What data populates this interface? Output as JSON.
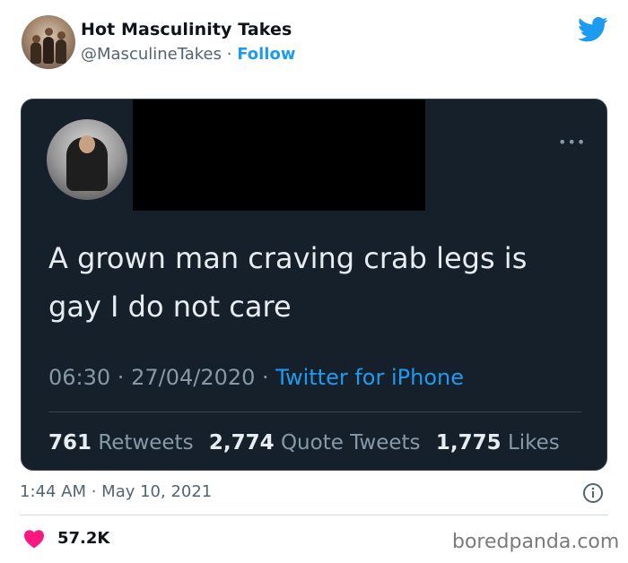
{
  "author": {
    "name": "Hot Masculinity Takes",
    "handle": "@MasculineTakes",
    "separator": " · ",
    "follow_label": "Follow"
  },
  "embedded_tweet": {
    "text_line1": "A grown man craving crab legs is",
    "text_line2": "gay I do not care",
    "time": "06:30",
    "date": "27/04/2020",
    "source": "Twitter for iPhone",
    "more_label": "•••",
    "stats": [
      {
        "count": "761",
        "label": "Retweets"
      },
      {
        "count": "2,774",
        "label": "Quote Tweets"
      },
      {
        "count": "1,775",
        "label": "Likes"
      }
    ]
  },
  "post_meta": {
    "time": "1:44 AM",
    "date": "May 10, 2021"
  },
  "engagement": {
    "likes": "57.2K"
  },
  "watermark": "boredpanda.com",
  "colors": {
    "twitter_blue": "#1d9bf0",
    "card_bg": "#15202b",
    "heart": "#f91880"
  },
  "icons": [
    "twitter-bird-icon",
    "more-icon",
    "info-icon",
    "heart-icon"
  ]
}
